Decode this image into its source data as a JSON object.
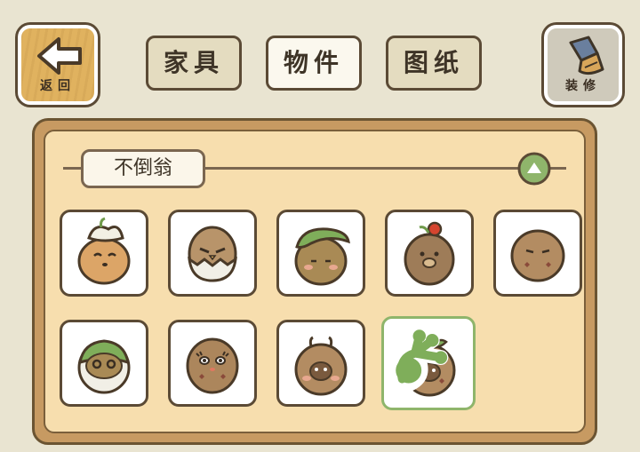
{
  "header": {
    "back_label": "返回",
    "decorate_label": "装修",
    "tabs": [
      {
        "label": "家具",
        "active": false
      },
      {
        "label": "物件",
        "active": true
      },
      {
        "label": "图纸",
        "active": false
      }
    ]
  },
  "category": {
    "label": "不倒翁",
    "collapse_icon": "triangle-up-icon"
  },
  "items": [
    {
      "name": "daruma-leaf-hat",
      "selected": false
    },
    {
      "name": "daruma-eggshell",
      "selected": false
    },
    {
      "name": "daruma-big-leaf",
      "selected": false
    },
    {
      "name": "daruma-berry",
      "selected": false
    },
    {
      "name": "daruma-plain",
      "selected": false
    },
    {
      "name": "daruma-turnip",
      "selected": false
    },
    {
      "name": "daruma-lashes",
      "selected": false
    },
    {
      "name": "daruma-antenna",
      "selected": false
    },
    {
      "name": "daruma-sprout",
      "selected": true
    }
  ],
  "colors": {
    "accent_green": "#8fb56b",
    "wood": "#e0b25f",
    "panel": "#f7deae",
    "outline": "#5b4a35"
  }
}
